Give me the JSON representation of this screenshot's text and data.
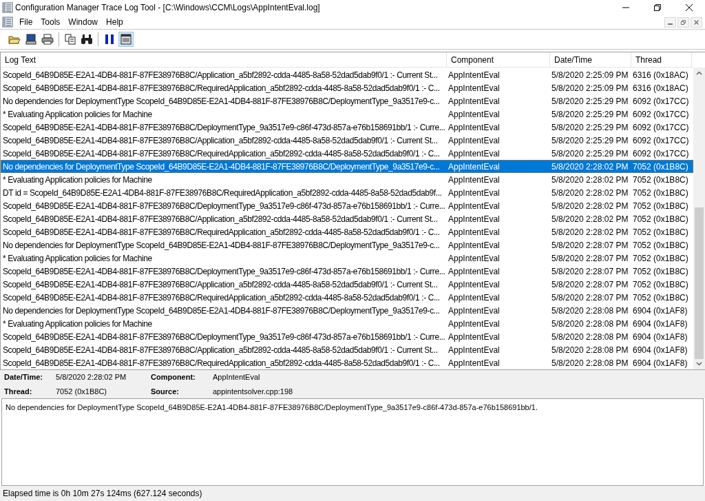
{
  "window": {
    "title": "Configuration Manager Trace Log Tool - [C:\\Windows\\CCM\\Logs\\AppIntentEval.log]"
  },
  "menu": [
    "File",
    "Tools",
    "Window",
    "Help"
  ],
  "toolbar": [
    {
      "pressed": false
    },
    {
      "pressed": false
    },
    {
      "pressed": false
    },
    {
      "pressed": false
    },
    {
      "pressed": false
    },
    {
      "pressed": false
    },
    {
      "pressed": true
    }
  ],
  "table": {
    "columns": [
      "Log Text",
      "Component",
      "Date/Time",
      "Thread"
    ],
    "rows": [
      {
        "text": "ScopeId_64B9D85E-E2A1-4DB4-881F-87FE38976B8C/Application_a5bf2892-cdda-4485-8a58-52dad5dab9f0/1 :- Current St...",
        "component": "AppIntentEval",
        "datetime": "5/8/2020 2:25:09 PM",
        "thread": "6316 (0x18AC)",
        "selected": false
      },
      {
        "text": "ScopeId_64B9D85E-E2A1-4DB4-881F-87FE38976B8C/RequiredApplication_a5bf2892-cdda-4485-8a58-52dad5dab9f0/1 :- C...",
        "component": "AppIntentEval",
        "datetime": "5/8/2020 2:25:09 PM",
        "thread": "6316 (0x18AC)",
        "selected": false
      },
      {
        "text": "No dependencies for DeploymentType ScopeId_64B9D85E-E2A1-4DB4-881F-87FE38976B8C/DeploymentType_9a3517e9-c...",
        "component": "AppIntentEval",
        "datetime": "5/8/2020 2:25:29 PM",
        "thread": "6092 (0x17CC)",
        "selected": false
      },
      {
        "text": "* Evaluating Application policies for Machine",
        "component": "AppIntentEval",
        "datetime": "5/8/2020 2:25:29 PM",
        "thread": "6092 (0x17CC)",
        "selected": false
      },
      {
        "text": "ScopeId_64B9D85E-E2A1-4DB4-881F-87FE38976B8C/DeploymentType_9a3517e9-c86f-473d-857a-e76b158691bb/1 :- Curre...",
        "component": "AppIntentEval",
        "datetime": "5/8/2020 2:25:29 PM",
        "thread": "6092 (0x17CC)",
        "selected": false
      },
      {
        "text": "ScopeId_64B9D85E-E2A1-4DB4-881F-87FE38976B8C/Application_a5bf2892-cdda-4485-8a58-52dad5dab9f0/1 :- Current St...",
        "component": "AppIntentEval",
        "datetime": "5/8/2020 2:25:29 PM",
        "thread": "6092 (0x17CC)",
        "selected": false
      },
      {
        "text": "ScopeId_64B9D85E-E2A1-4DB4-881F-87FE38976B8C/RequiredApplication_a5bf2892-cdda-4485-8a58-52dad5dab9f0/1 :- C...",
        "component": "AppIntentEval",
        "datetime": "5/8/2020 2:25:29 PM",
        "thread": "6092 (0x17CC)",
        "selected": false
      },
      {
        "text": "No dependencies for DeploymentType ScopeId_64B9D85E-E2A1-4DB4-881F-87FE38976B8C/DeploymentType_9a3517e9-c...",
        "component": "AppIntentEval",
        "datetime": "5/8/2020 2:28:02 PM",
        "thread": "7052 (0x1B8C)",
        "selected": true
      },
      {
        "text": "* Evaluating Application policies for Machine",
        "component": "AppIntentEval",
        "datetime": "5/8/2020 2:28:02 PM",
        "thread": "7052 (0x1B8C)",
        "selected": false
      },
      {
        "text": "DT id = ScopeId_64B9D85E-E2A1-4DB4-881F-87FE38976B8C/RequiredApplication_a5bf2892-cdda-4485-8a58-52dad5dab9f...",
        "component": "AppIntentEval",
        "datetime": "5/8/2020 2:28:02 PM",
        "thread": "7052 (0x1B8C)",
        "selected": false
      },
      {
        "text": "ScopeId_64B9D85E-E2A1-4DB4-881F-87FE38976B8C/DeploymentType_9a3517e9-c86f-473d-857a-e76b158691bb/1 :- Curre...",
        "component": "AppIntentEval",
        "datetime": "5/8/2020 2:28:02 PM",
        "thread": "7052 (0x1B8C)",
        "selected": false
      },
      {
        "text": "ScopeId_64B9D85E-E2A1-4DB4-881F-87FE38976B8C/Application_a5bf2892-cdda-4485-8a58-52dad5dab9f0/1 :- Current St...",
        "component": "AppIntentEval",
        "datetime": "5/8/2020 2:28:02 PM",
        "thread": "7052 (0x1B8C)",
        "selected": false
      },
      {
        "text": "ScopeId_64B9D85E-E2A1-4DB4-881F-87FE38976B8C/RequiredApplication_a5bf2892-cdda-4485-8a58-52dad5dab9f0/1 :- C...",
        "component": "AppIntentEval",
        "datetime": "5/8/2020 2:28:02 PM",
        "thread": "7052 (0x1B8C)",
        "selected": false
      },
      {
        "text": "No dependencies for DeploymentType ScopeId_64B9D85E-E2A1-4DB4-881F-87FE38976B8C/DeploymentType_9a3517e9-c...",
        "component": "AppIntentEval",
        "datetime": "5/8/2020 2:28:07 PM",
        "thread": "7052 (0x1B8C)",
        "selected": false
      },
      {
        "text": "* Evaluating Application policies for Machine",
        "component": "AppIntentEval",
        "datetime": "5/8/2020 2:28:07 PM",
        "thread": "7052 (0x1B8C)",
        "selected": false
      },
      {
        "text": "ScopeId_64B9D85E-E2A1-4DB4-881F-87FE38976B8C/DeploymentType_9a3517e9-c86f-473d-857a-e76b158691bb/1 :- Curre...",
        "component": "AppIntentEval",
        "datetime": "5/8/2020 2:28:07 PM",
        "thread": "7052 (0x1B8C)",
        "selected": false
      },
      {
        "text": "ScopeId_64B9D85E-E2A1-4DB4-881F-87FE38976B8C/Application_a5bf2892-cdda-4485-8a58-52dad5dab9f0/1 :- Current St...",
        "component": "AppIntentEval",
        "datetime": "5/8/2020 2:28:07 PM",
        "thread": "7052 (0x1B8C)",
        "selected": false
      },
      {
        "text": "ScopeId_64B9D85E-E2A1-4DB4-881F-87FE38976B8C/RequiredApplication_a5bf2892-cdda-4485-8a58-52dad5dab9f0/1 :- C...",
        "component": "AppIntentEval",
        "datetime": "5/8/2020 2:28:07 PM",
        "thread": "7052 (0x1B8C)",
        "selected": false
      },
      {
        "text": "No dependencies for DeploymentType ScopeId_64B9D85E-E2A1-4DB4-881F-87FE38976B8C/DeploymentType_9a3517e9-c...",
        "component": "AppIntentEval",
        "datetime": "5/8/2020 2:28:08 PM",
        "thread": "6904 (0x1AF8)",
        "selected": false
      },
      {
        "text": "* Evaluating Application policies for Machine",
        "component": "AppIntentEval",
        "datetime": "5/8/2020 2:28:08 PM",
        "thread": "6904 (0x1AF8)",
        "selected": false
      },
      {
        "text": "ScopeId_64B9D85E-E2A1-4DB4-881F-87FE38976B8C/DeploymentType_9a3517e9-c86f-473d-857a-e76b158691bb/1 :- Curre...",
        "component": "AppIntentEval",
        "datetime": "5/8/2020 2:28:08 PM",
        "thread": "6904 (0x1AF8)",
        "selected": false
      },
      {
        "text": "ScopeId_64B9D85E-E2A1-4DB4-881F-87FE38976B8C/Application_a5bf2892-cdda-4485-8a58-52dad5dab9f0/1 :- Current St...",
        "component": "AppIntentEval",
        "datetime": "5/8/2020 2:28:08 PM",
        "thread": "6904 (0x1AF8)",
        "selected": false
      },
      {
        "text": "ScopeId_64B9D85E-E2A1-4DB4-881F-87FE38976B8C/RequiredApplication_a5bf2892-cdda-4485-8a58-52dad5dab9f0/1 :- C...",
        "component": "AppIntentEval",
        "datetime": "5/8/2020 2:28:08 PM",
        "thread": "6904 (0x1AF8)",
        "selected": false
      }
    ]
  },
  "details": [
    {
      "label": "Date/Time:",
      "value": "5/8/2020 2:28:02 PM"
    },
    {
      "label": "Component:",
      "value": "AppIntentEval"
    },
    {
      "label": "Thread:",
      "value": "7052 (0x1B8C)"
    },
    {
      "label": "Source:",
      "value": "appintentsolver.cpp:198"
    }
  ],
  "message": "No dependencies for DeploymentType ScopeId_64B9D85E-E2A1-4DB4-881F-87FE38976B8C/DeploymentType_9a3517e9-c86f-473d-857a-e76b158691bb/1.",
  "status_bar": "Elapsed time is 0h 10m 27s 124ms (627.124 seconds)"
}
